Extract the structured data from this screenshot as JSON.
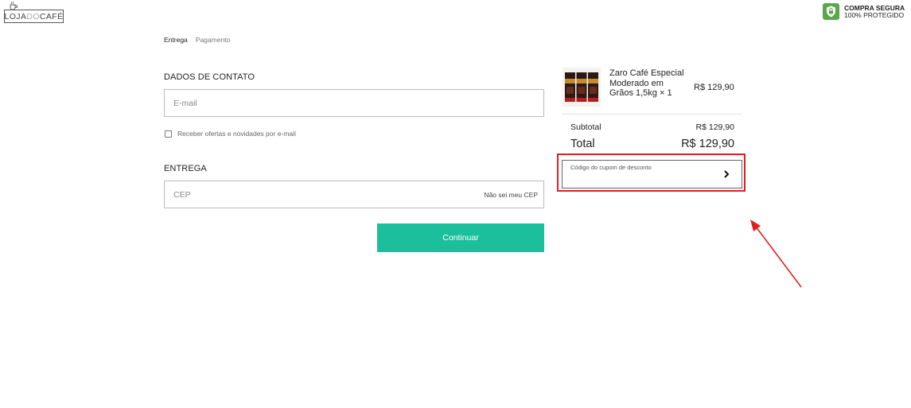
{
  "header": {
    "logo": {
      "part1": "LOJA",
      "part2": "DO",
      "part3": "CAFÉ"
    },
    "secure": {
      "line1": "COMPRA SEGURA",
      "line2": "100% PROTEGIDO",
      "icon": "lock-icon"
    }
  },
  "breadcrumb": {
    "step1": "Entrega",
    "step2": "Pagamento"
  },
  "contact": {
    "title": "DADOS DE CONTATO",
    "email_placeholder": "E-mail",
    "email_value": "",
    "newsletter_label": "Receber ofertas e novidades por e-mail",
    "newsletter_checked": false
  },
  "delivery": {
    "title": "ENTREGA",
    "cep_placeholder": "CEP",
    "cep_value": "",
    "cep_link": "Não sei meu CEP"
  },
  "actions": {
    "continue_label": "Continuar"
  },
  "summary": {
    "product": {
      "name": "Zaro Café Especial Moderado em Grãos 1,5kg × 1",
      "price": "R$ 129,90"
    },
    "subtotal_label": "Subtotal",
    "subtotal_value": "R$ 129,90",
    "total_label": "Total",
    "total_value": "R$ 129,90",
    "coupon_label": "Código do cupom de desconto"
  },
  "colors": {
    "accent": "#1cbf9c",
    "secure": "#5aa64a",
    "annotation": "#e02020"
  }
}
